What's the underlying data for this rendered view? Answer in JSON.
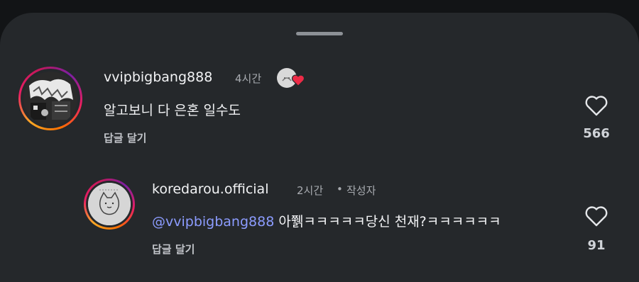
{
  "comments": [
    {
      "username": "vvipbigbang888",
      "time": "4시간",
      "text": "알고보니 다 은혼 일수도",
      "reply_label": "답글 달기",
      "like_count": "566",
      "liked_by_author": true
    },
    {
      "username": "koredarou.official",
      "time": "2시간",
      "separator": "•",
      "author_tag": "작성자",
      "mention": "@vvipbigbang888",
      "text": " 아쮉ㅋㅋㅋㅋㅋ당신 천재?ㅋㅋㅋㅋㅋㅋ",
      "reply_label": "답글 달기",
      "like_count": "91"
    }
  ],
  "colors": {
    "sheet_bg": "#25282b",
    "mention": "#8c9cff",
    "liked_heart": "#ed2b47"
  }
}
